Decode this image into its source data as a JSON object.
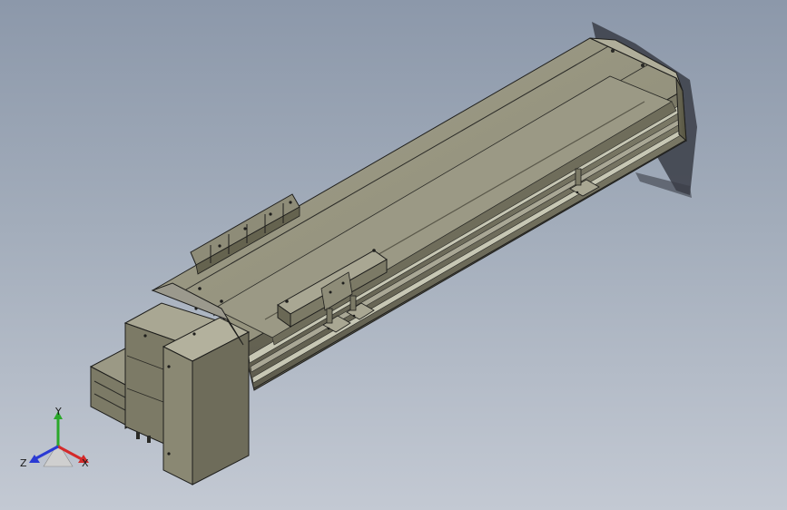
{
  "view": {
    "background_top": "#8c98aa",
    "background_bottom": "#c3c9d3",
    "model_color": "#8e8c78",
    "edge_color": "#1e1e1c"
  },
  "triad": {
    "x_label": "X",
    "y_label": "Y",
    "z_label": "Z",
    "x_color": "#d42a2a",
    "y_color": "#2aa82a",
    "z_color": "#2a3ad4"
  }
}
